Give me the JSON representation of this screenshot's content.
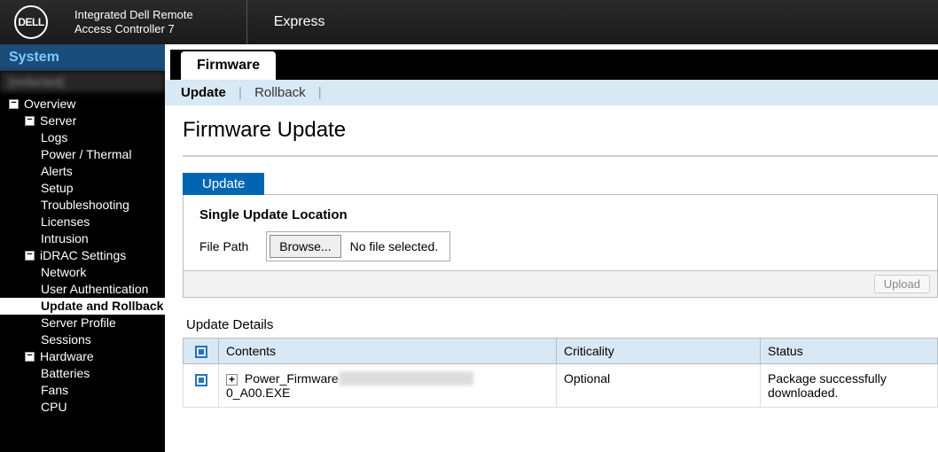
{
  "header": {
    "logo_text": "DELL",
    "title_l1": "Integrated Dell Remote",
    "title_l2": "Access Controller 7",
    "mode": "Express"
  },
  "sidebar": {
    "head": "System",
    "sub": "[redacted]",
    "tree": {
      "overview": "Overview",
      "server": "Server",
      "logs": "Logs",
      "power_thermal": "Power / Thermal",
      "alerts": "Alerts",
      "setup": "Setup",
      "troubleshooting": "Troubleshooting",
      "licenses": "Licenses",
      "intrusion": "Intrusion",
      "idrac": "iDRAC Settings",
      "network": "Network",
      "user_auth": "User Authentication",
      "update_rollback": "Update and Rollback",
      "server_profile": "Server Profile",
      "sessions": "Sessions",
      "hardware": "Hardware",
      "batteries": "Batteries",
      "fans": "Fans",
      "cpu": "CPU"
    }
  },
  "main": {
    "tab": "Firmware",
    "subtabs": {
      "update": "Update",
      "rollback": "Rollback"
    },
    "title": "Firmware Update",
    "inner_tab": "Update",
    "box_title": "Single Update Location",
    "file_label": "File Path",
    "browse": "Browse...",
    "file_status": "No file selected.",
    "upload": "Upload",
    "details_title": "Update Details",
    "columns": {
      "contents": "Contents",
      "criticality": "Criticality",
      "status": "Status"
    },
    "row": {
      "contents_prefix": "Power_Firmware",
      "contents_redacted": "_XXXX_XXXXX_XXXX_",
      "contents_suffix": "0_A00.EXE",
      "criticality": "Optional",
      "status": "Package successfully downloaded."
    }
  },
  "glyphs": {
    "minus": "−",
    "plus": "+"
  }
}
